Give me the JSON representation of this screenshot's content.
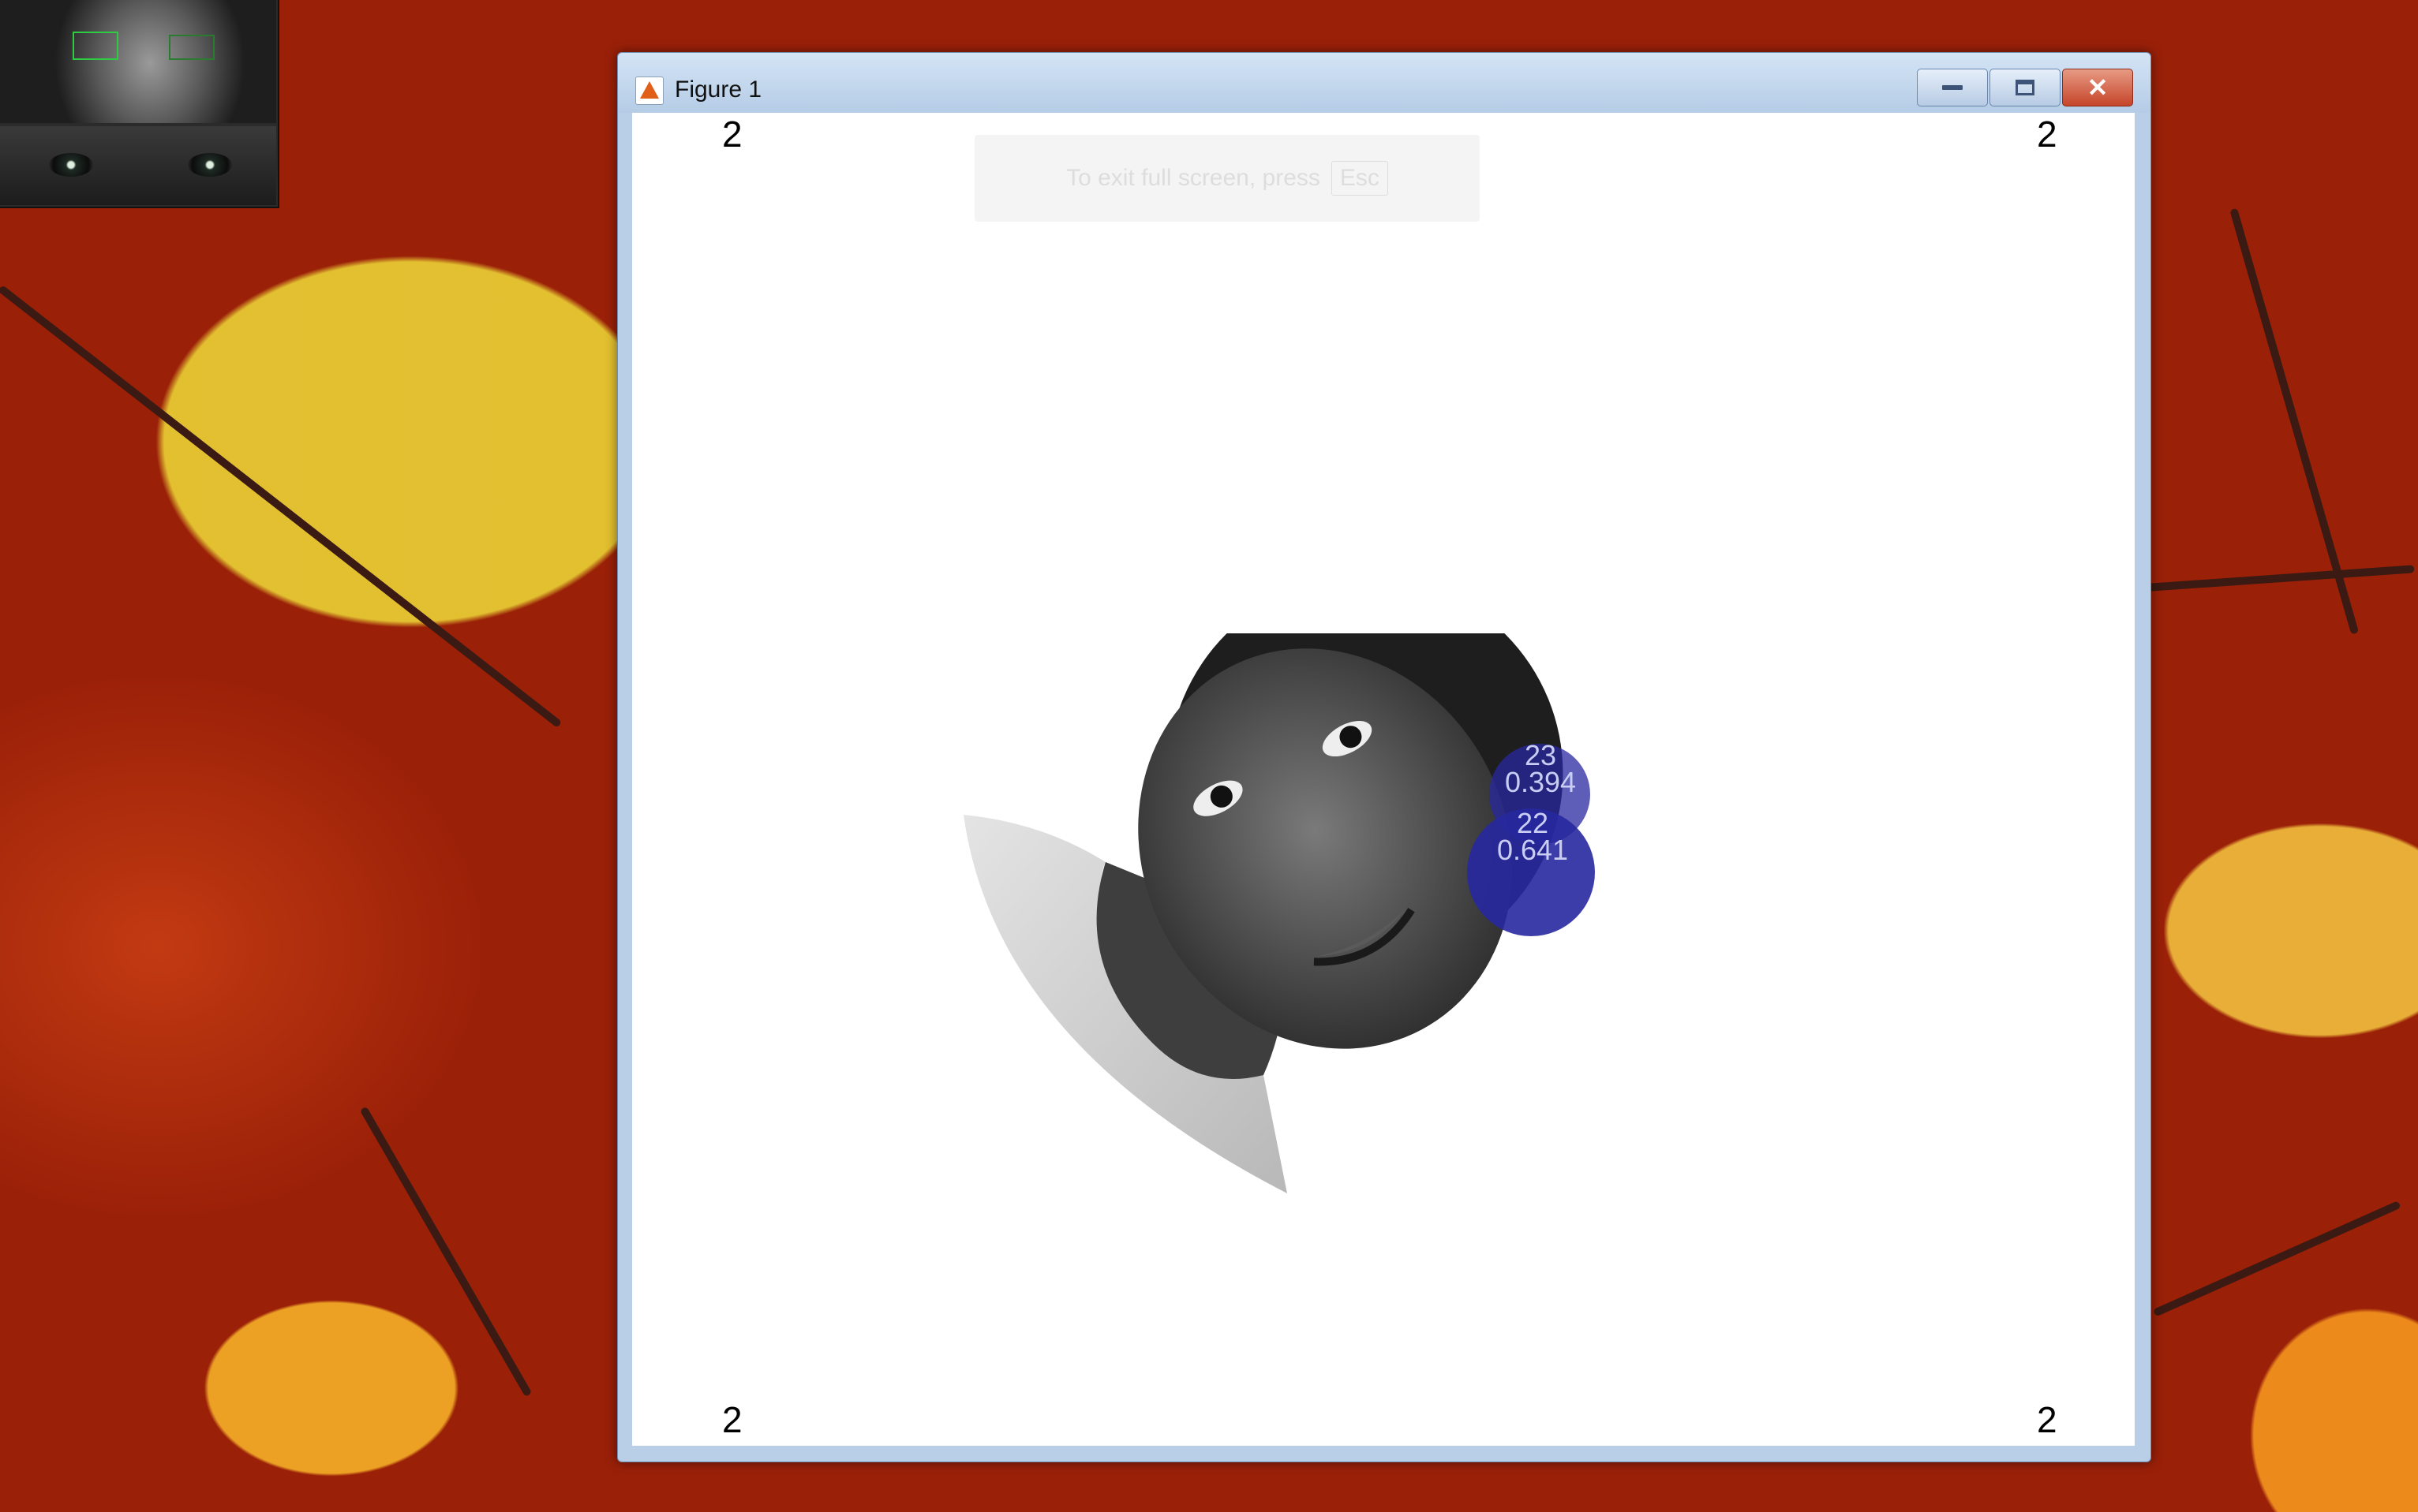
{
  "window": {
    "title": "Figure 1",
    "controls": {
      "minimize": "minimize",
      "maximize": "maximize",
      "close": "✕"
    }
  },
  "fullscreen_notice": {
    "text": "To exit full screen, press",
    "key": "Esc"
  },
  "figure": {
    "corner_labels": {
      "top_left": "2",
      "top_right": "2",
      "bottom_left": "2",
      "bottom_right": "2"
    },
    "fixations": [
      {
        "id": "23",
        "value": "0.394"
      },
      {
        "id": "22",
        "value": "0.641"
      }
    ]
  },
  "colors": {
    "fixation_fill": "#28289f",
    "window_frame": "#b9cfe7",
    "close_button": "#c5452a"
  }
}
